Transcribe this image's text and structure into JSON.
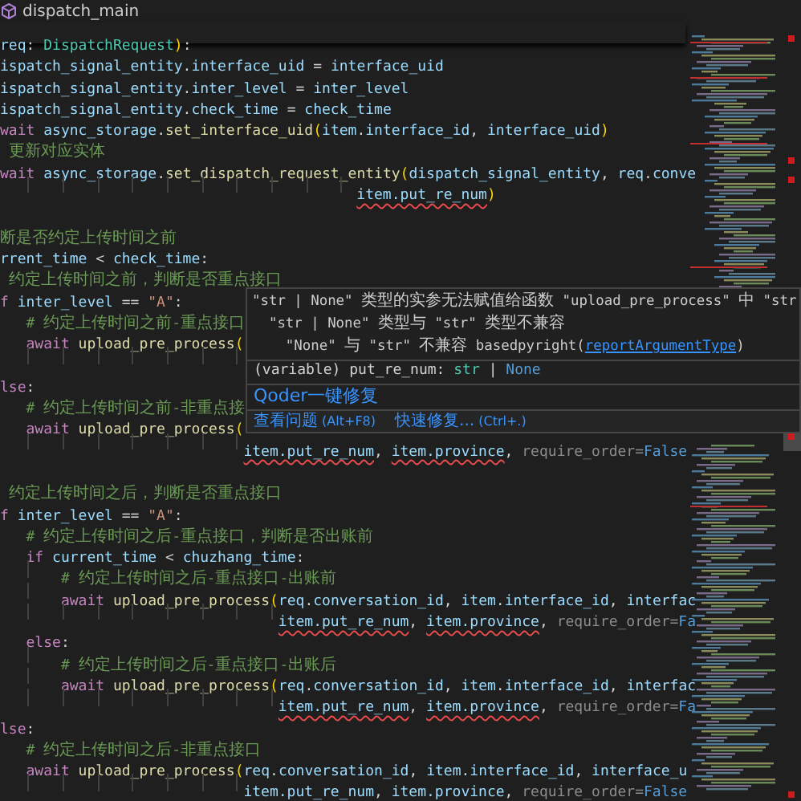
{
  "breadcrumb": {
    "title": "dispatch_main"
  },
  "sticky_line": {
    "tokens": [
      {
        "text": "req",
        "kind": "variable"
      },
      {
        "text": ": ",
        "kind": "plain"
      },
      {
        "text": "DispatchRequest",
        "kind": "class"
      },
      {
        "text": ")",
        "kind": "bracket"
      },
      {
        "text": ":",
        "kind": "plain"
      }
    ]
  },
  "lines": [
    {
      "kind": "code",
      "tokens": [
        {
          "text": "ispatch_signal_entity",
          "kind": "variable"
        },
        {
          "text": ".",
          "kind": "plain"
        },
        {
          "text": "interface_uid",
          "kind": "variable"
        },
        {
          "text": " = ",
          "kind": "plain"
        },
        {
          "text": "interface_uid",
          "kind": "variable"
        }
      ]
    },
    {
      "kind": "code",
      "tokens": [
        {
          "text": "ispatch_signal_entity",
          "kind": "variable"
        },
        {
          "text": ".",
          "kind": "plain"
        },
        {
          "text": "inter_level",
          "kind": "variable"
        },
        {
          "text": " = ",
          "kind": "plain"
        },
        {
          "text": "inter_level",
          "kind": "variable"
        }
      ]
    },
    {
      "kind": "code",
      "tokens": [
        {
          "text": "ispatch_signal_entity",
          "kind": "variable"
        },
        {
          "text": ".",
          "kind": "plain"
        },
        {
          "text": "check_time",
          "kind": "variable"
        },
        {
          "text": " = ",
          "kind": "plain"
        },
        {
          "text": "check_time",
          "kind": "variable"
        }
      ]
    },
    {
      "kind": "code",
      "tokens": [
        {
          "text": "wait",
          "kind": "keyword"
        },
        {
          "text": " async_storage",
          "kind": "variable"
        },
        {
          "text": ".",
          "kind": "plain"
        },
        {
          "text": "set_interface_uid",
          "kind": "function"
        },
        {
          "text": "(",
          "kind": "bracket"
        },
        {
          "text": "item",
          "kind": "variable"
        },
        {
          "text": ".",
          "kind": "plain"
        },
        {
          "text": "interface_id",
          "kind": "variable"
        },
        {
          "text": ", ",
          "kind": "plain"
        },
        {
          "text": "interface_uid",
          "kind": "variable"
        },
        {
          "text": ")",
          "kind": "bracket"
        }
      ]
    },
    {
      "kind": "code",
      "tokens": [
        {
          "text": " 更新对应实体",
          "kind": "comment"
        }
      ]
    },
    {
      "kind": "code",
      "tokens": [
        {
          "text": "wait",
          "kind": "keyword"
        },
        {
          "text": " async_storage",
          "kind": "variable"
        },
        {
          "text": ".",
          "kind": "plain"
        },
        {
          "text": "set_dispatch_request_entity",
          "kind": "function"
        },
        {
          "text": "(",
          "kind": "bracket"
        },
        {
          "text": "dispatch_signal_entity",
          "kind": "variable"
        },
        {
          "text": ", ",
          "kind": "plain"
        },
        {
          "text": "req",
          "kind": "variable"
        },
        {
          "text": ".",
          "kind": "plain"
        },
        {
          "text": "conve",
          "kind": "variable"
        }
      ]
    },
    {
      "kind": "code",
      "tokens": [
        {
          "text": "                                         item.put_re_num",
          "kind": "error"
        },
        {
          "text": ")",
          "kind": "bracket"
        }
      ]
    },
    {
      "kind": "blank"
    },
    {
      "kind": "code",
      "tokens": [
        {
          "text": "断是否约定上传时间之前",
          "kind": "comment"
        }
      ]
    },
    {
      "kind": "code",
      "tokens": [
        {
          "text": "rrent_time",
          "kind": "variable"
        },
        {
          "text": " < ",
          "kind": "plain"
        },
        {
          "text": "check_time",
          "kind": "variable"
        },
        {
          "text": ":",
          "kind": "plain"
        }
      ]
    },
    {
      "kind": "code",
      "tokens": [
        {
          "text": " 约定上传时间之前，判断是否重点接口",
          "kind": "comment"
        }
      ]
    },
    {
      "kind": "code",
      "tokens": [
        {
          "text": "f",
          "kind": "keyword"
        },
        {
          "text": " inter_level",
          "kind": "variable"
        },
        {
          "text": " == ",
          "kind": "plain"
        },
        {
          "text": "\"A\"",
          "kind": "string"
        },
        {
          "text": ":",
          "kind": "plain"
        }
      ]
    },
    {
      "kind": "code",
      "tokens": [
        {
          "text": "   # 约定上传时间之前-重点接口",
          "kind": "comment"
        }
      ]
    },
    {
      "kind": "code",
      "tokens": [
        {
          "text": "   await",
          "kind": "keyword"
        },
        {
          "text": " upload_pre_process",
          "kind": "function"
        },
        {
          "text": "(",
          "kind": "bracket"
        }
      ]
    },
    {
      "kind": "guides"
    },
    {
      "kind": "code",
      "tokens": [
        {
          "text": "lse",
          "kind": "keyword"
        },
        {
          "text": ":",
          "kind": "plain"
        }
      ]
    },
    {
      "kind": "code",
      "tokens": [
        {
          "text": "   # 约定上传时间之前-非重点接",
          "kind": "comment"
        }
      ]
    },
    {
      "kind": "code",
      "tokens": [
        {
          "text": "   await",
          "kind": "keyword"
        },
        {
          "text": " upload_pre_process",
          "kind": "function"
        },
        {
          "text": "(",
          "kind": "bracket"
        }
      ]
    },
    {
      "kind": "code",
      "tokens": [
        {
          "text": "                            item.put_re_num",
          "kind": "error"
        },
        {
          "text": ", ",
          "kind": "plain"
        },
        {
          "text": "item.province",
          "kind": "error"
        },
        {
          "text": ", ",
          "kind": "plain"
        },
        {
          "text": "require_order=",
          "kind": "parameter"
        },
        {
          "text": "False",
          "kind": "constant"
        }
      ]
    },
    {
      "kind": "blank"
    },
    {
      "kind": "code",
      "tokens": [
        {
          "text": " 约定上传时间之后，判断是否重点接口",
          "kind": "comment"
        }
      ]
    },
    {
      "kind": "code",
      "tokens": [
        {
          "text": "f",
          "kind": "keyword"
        },
        {
          "text": " inter_level",
          "kind": "variable"
        },
        {
          "text": " == ",
          "kind": "plain"
        },
        {
          "text": "\"A\"",
          "kind": "string"
        },
        {
          "text": ":",
          "kind": "plain"
        }
      ]
    },
    {
      "kind": "code",
      "tokens": [
        {
          "text": "   # 约定上传时间之后-重点接口，判断是否出账前",
          "kind": "comment"
        }
      ]
    },
    {
      "kind": "code",
      "tokens": [
        {
          "text": "   if",
          "kind": "keyword"
        },
        {
          "text": " current_time",
          "kind": "variable"
        },
        {
          "text": " < ",
          "kind": "plain"
        },
        {
          "text": "chuzhang_time",
          "kind": "variable"
        },
        {
          "text": ":",
          "kind": "plain"
        }
      ]
    },
    {
      "kind": "code",
      "tokens": [
        {
          "text": "       # 约定上传时间之后-重点接口-出账前",
          "kind": "comment"
        }
      ]
    },
    {
      "kind": "code",
      "tokens": [
        {
          "text": "       await",
          "kind": "keyword"
        },
        {
          "text": " upload_pre_process",
          "kind": "function"
        },
        {
          "text": "(",
          "kind": "bracket"
        },
        {
          "text": "req",
          "kind": "variable"
        },
        {
          "text": ".",
          "kind": "plain"
        },
        {
          "text": "conversation_id",
          "kind": "variable"
        },
        {
          "text": ", ",
          "kind": "plain"
        },
        {
          "text": "item",
          "kind": "variable"
        },
        {
          "text": ".",
          "kind": "plain"
        },
        {
          "text": "interface_id",
          "kind": "variable"
        },
        {
          "text": ", ",
          "kind": "plain"
        },
        {
          "text": "interfac",
          "kind": "variable"
        }
      ]
    },
    {
      "kind": "code",
      "tokens": [
        {
          "text": "                                item.put_re_num",
          "kind": "error"
        },
        {
          "text": ", ",
          "kind": "plain"
        },
        {
          "text": "item.province",
          "kind": "error"
        },
        {
          "text": ", ",
          "kind": "plain"
        },
        {
          "text": "require_order=",
          "kind": "parameter"
        },
        {
          "text": "Fa",
          "kind": "constant"
        }
      ]
    },
    {
      "kind": "code",
      "tokens": [
        {
          "text": "   else",
          "kind": "keyword"
        },
        {
          "text": ":",
          "kind": "plain"
        }
      ]
    },
    {
      "kind": "code",
      "tokens": [
        {
          "text": "       # 约定上传时间之后-重点接口-出账后",
          "kind": "comment"
        }
      ]
    },
    {
      "kind": "code",
      "tokens": [
        {
          "text": "       await",
          "kind": "keyword"
        },
        {
          "text": " upload_pre_process",
          "kind": "function"
        },
        {
          "text": "(",
          "kind": "bracket"
        },
        {
          "text": "req",
          "kind": "variable"
        },
        {
          "text": ".",
          "kind": "plain"
        },
        {
          "text": "conversation_id",
          "kind": "variable"
        },
        {
          "text": ", ",
          "kind": "plain"
        },
        {
          "text": "item",
          "kind": "variable"
        },
        {
          "text": ".",
          "kind": "plain"
        },
        {
          "text": "interface_id",
          "kind": "variable"
        },
        {
          "text": ", ",
          "kind": "plain"
        },
        {
          "text": "interfac",
          "kind": "variable"
        }
      ]
    },
    {
      "kind": "code",
      "tokens": [
        {
          "text": "                                item.put_re_num",
          "kind": "error"
        },
        {
          "text": ", ",
          "kind": "plain"
        },
        {
          "text": "item.province",
          "kind": "error"
        },
        {
          "text": ", ",
          "kind": "plain"
        },
        {
          "text": "require_order=",
          "kind": "parameter"
        },
        {
          "text": "Fa",
          "kind": "constant"
        }
      ]
    },
    {
      "kind": "code",
      "tokens": [
        {
          "text": "lse",
          "kind": "keyword"
        },
        {
          "text": ":",
          "kind": "plain"
        }
      ]
    },
    {
      "kind": "code",
      "tokens": [
        {
          "text": "   # 约定上传时间之后-非重点接口",
          "kind": "comment"
        }
      ]
    },
    {
      "kind": "code",
      "tokens": [
        {
          "text": "   await",
          "kind": "keyword"
        },
        {
          "text": " upload_pre_process",
          "kind": "function"
        },
        {
          "text": "(",
          "kind": "bracket"
        },
        {
          "text": "req",
          "kind": "variable"
        },
        {
          "text": ".",
          "kind": "plain"
        },
        {
          "text": "conversation_id",
          "kind": "variable"
        },
        {
          "text": ", ",
          "kind": "plain"
        },
        {
          "text": "item",
          "kind": "variable"
        },
        {
          "text": ".",
          "kind": "plain"
        },
        {
          "text": "interface_id",
          "kind": "variable"
        },
        {
          "text": ", ",
          "kind": "plain"
        },
        {
          "text": "interface_u",
          "kind": "variable"
        }
      ]
    },
    {
      "kind": "code",
      "tokens": [
        {
          "text": "                            item.put_re_num",
          "kind": "error"
        },
        {
          "text": ", ",
          "kind": "plain"
        },
        {
          "text": "item.province",
          "kind": "error"
        },
        {
          "text": ", ",
          "kind": "plain"
        },
        {
          "text": "require_order=",
          "kind": "parameter"
        },
        {
          "text": "False",
          "kind": "constant"
        }
      ]
    }
  ],
  "hover": {
    "message": [
      "\"str | None\" 类型的实参无法赋值给函数 \"upload_pre_process\" 中 \"str",
      "  \"str | None\" 类型与 \"str\" 类型不兼容"
    ],
    "detail": "    \"None\" 与 \"str\" 不兼容 basedpyright(",
    "rule": "reportArgumentType",
    "detail_end": ")",
    "signature": [
      {
        "text": "(variable) put_re_num: ",
        "kind": "plain"
      },
      {
        "text": "str",
        "kind": "class"
      },
      {
        "text": " | ",
        "kind": "plain"
      },
      {
        "text": "None",
        "kind": "constant"
      }
    ],
    "action": "Qoder一键修复",
    "footer": [
      {
        "label": "查看问题",
        "shortcut": "(Alt+F8)"
      },
      {
        "label": "快速修复...",
        "shortcut": "(Ctrl+.)"
      }
    ]
  }
}
